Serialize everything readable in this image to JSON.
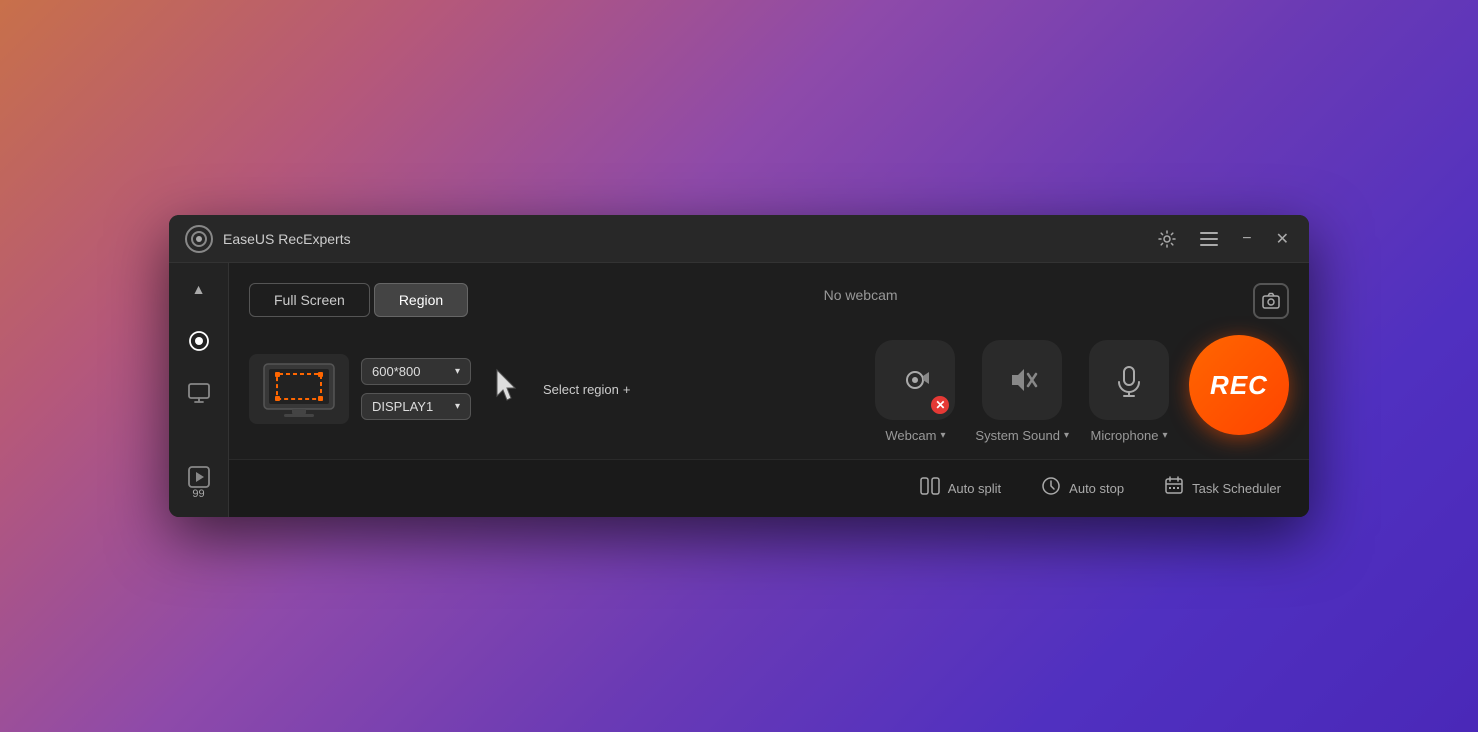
{
  "window": {
    "title": "EaseUS RecExperts"
  },
  "titlebar": {
    "minimize_label": "−",
    "close_label": "✕",
    "menu_label": "≡"
  },
  "tabs": {
    "full_screen": "Full Screen",
    "region": "Region",
    "active_tab": "region"
  },
  "webcam": {
    "label": "No webcam"
  },
  "region": {
    "resolution": "600*800",
    "display": "DISPLAY1",
    "select_region": "Select region",
    "select_region_plus": "+"
  },
  "media": {
    "webcam_label": "Webcam",
    "system_sound_label": "System Sound",
    "microphone_label": "Microphone"
  },
  "rec": {
    "label": "REC"
  },
  "bottom": {
    "auto_split": "Auto split",
    "auto_stop": "Auto stop",
    "task_scheduler": "Task Scheduler"
  },
  "sidebar": {
    "badge_count": "99"
  }
}
